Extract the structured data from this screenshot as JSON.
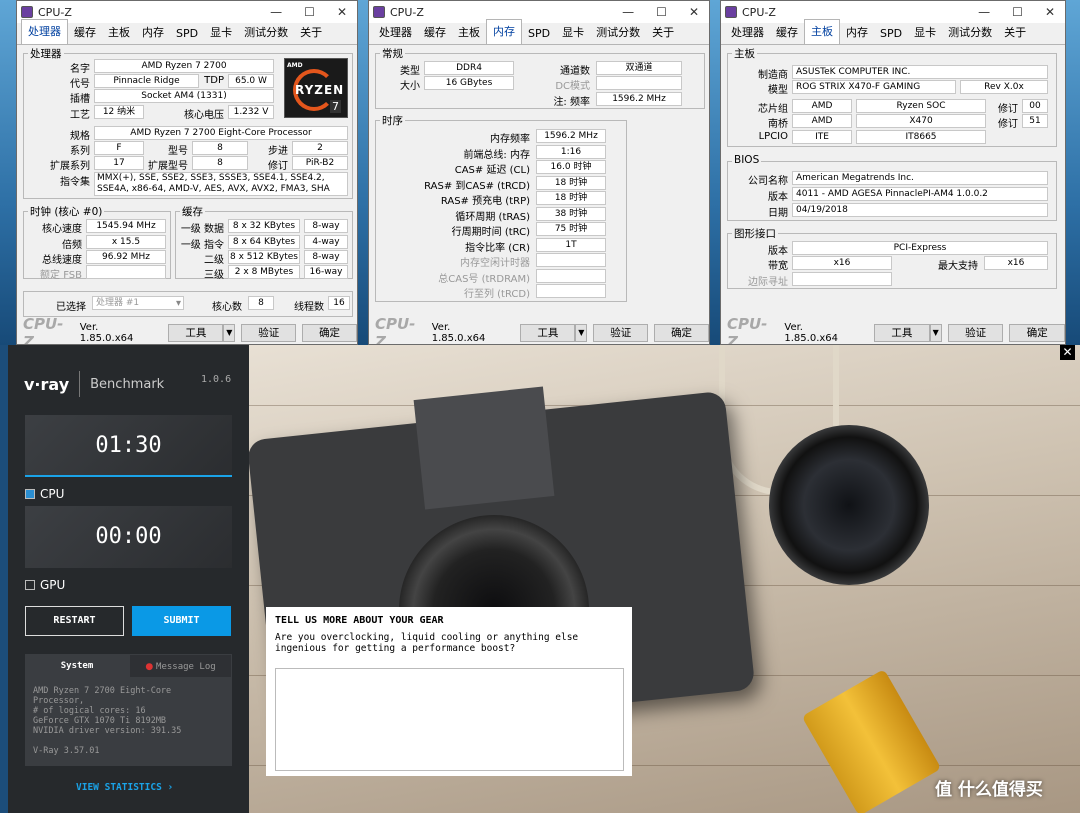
{
  "cpuz_cpu": {
    "title": "CPU-Z",
    "tabs": [
      "处理器",
      "缓存",
      "主板",
      "内存",
      "SPD",
      "显卡",
      "测试分数",
      "关于"
    ],
    "proc_group": "处理器",
    "name_l": "名字",
    "name_v": "AMD Ryzen 7 2700",
    "code_l": "代号",
    "code_v": "Pinnacle Ridge",
    "tdp_l": "TDP",
    "tdp_v": "65.0 W",
    "socket_l": "插槽",
    "socket_v": "Socket AM4 (1331)",
    "tech_l": "工艺",
    "tech_v": "12 纳米",
    "volt_l": "核心电压",
    "volt_v": "1.232 V",
    "spec_l": "规格",
    "spec_v": "AMD Ryzen 7 2700 Eight-Core Processor",
    "fam_l": "系列",
    "fam_v": "F",
    "model_l": "型号",
    "model_v": "8",
    "step_l": "步进",
    "step_v": "2",
    "extfam_l": "扩展系列",
    "extfam_v": "17",
    "extmod_l": "扩展型号",
    "extmod_v": "8",
    "rev_l": "修订",
    "rev_v": "PiR-B2",
    "instr_l": "指令集",
    "instr_v": "MMX(+), SSE, SSE2, SSE3, SSSE3, SSE4.1, SSE4.2, SSE4A, x86-64, AMD-V, AES, AVX, AVX2, FMA3, SHA",
    "clock_group": "时钟 (核心 #0)",
    "corespd_l": "核心速度",
    "corespd_v": "1545.94 MHz",
    "mult_l": "倍频",
    "mult_v": "x 15.5",
    "bus_l": "总线速度",
    "bus_v": "96.92 MHz",
    "fsb_l": "额定 FSB",
    "fsb_v": "",
    "cache_group": "缓存",
    "l1d_l": "一级 数据",
    "l1d_v": "8 x 32 KBytes",
    "l1d_w": "8-way",
    "l1i_l": "一级 指令",
    "l1i_v": "8 x 64 KBytes",
    "l1i_w": "4-way",
    "l2_l": "二级",
    "l2_v": "8 x 512 KBytes",
    "l2_w": "8-way",
    "l3_l": "三级",
    "l3_v": "2 x 8 MBytes",
    "l3_w": "16-way",
    "sel_l": "已选择",
    "sel_v": "处理器 #1",
    "cores_l": "核心数",
    "cores_v": "8",
    "threads_l": "线程数",
    "threads_v": "16",
    "logo": {
      "brand": "AMD",
      "product": "RYZEN",
      "tier": "7"
    }
  },
  "cpuz_mem": {
    "title": "CPU-Z",
    "tabs": [
      "处理器",
      "缓存",
      "主板",
      "内存",
      "SPD",
      "显卡",
      "测试分数",
      "关于"
    ],
    "gen_group": "常规",
    "type_l": "类型",
    "type_v": "DDR4",
    "ch_l": "通道数",
    "ch_v": "双通道",
    "size_l": "大小",
    "size_v": "16 GBytes",
    "dc_l": "DC模式",
    "dc_v": "",
    "nb_l": "注: 频率",
    "nb_v": "1596.2 MHz",
    "tim_group": "时序",
    "rows": [
      {
        "l": "内存频率",
        "v": "1596.2 MHz",
        "dim": false
      },
      {
        "l": "前端总线: 内存",
        "v": "1:16",
        "dim": false
      },
      {
        "l": "CAS# 延迟 (CL)",
        "v": "16.0 时钟",
        "dim": false
      },
      {
        "l": "RAS# 到CAS# (tRCD)",
        "v": "18 时钟",
        "dim": false
      },
      {
        "l": "RAS# 预充电 (tRP)",
        "v": "18 时钟",
        "dim": false
      },
      {
        "l": "循环周期 (tRAS)",
        "v": "38 时钟",
        "dim": false
      },
      {
        "l": "行周期时间 (tRC)",
        "v": "75 时钟",
        "dim": false
      },
      {
        "l": "指令比率 (CR)",
        "v": "1T",
        "dim": false
      },
      {
        "l": "内存空闲计时器",
        "v": "",
        "dim": true
      },
      {
        "l": "总CAS号 (tRDRAM)",
        "v": "",
        "dim": true
      },
      {
        "l": "行至列 (tRCD)",
        "v": "",
        "dim": true
      }
    ]
  },
  "cpuz_mb": {
    "title": "CPU-Z",
    "tabs": [
      "处理器",
      "缓存",
      "主板",
      "内存",
      "SPD",
      "显卡",
      "测试分数",
      "关于"
    ],
    "mb_group": "主板",
    "mfr_l": "制造商",
    "mfr_v": "ASUSTeK COMPUTER INC.",
    "model_l": "模型",
    "model_v": "ROG STRIX X470-F GAMING",
    "model_rev": "Rev X.0x",
    "chip_l": "芯片组",
    "chip_v1": "AMD",
    "chip_v2": "Ryzen SOC",
    "chip_rl": "修订",
    "chip_rv": "00",
    "sb_l": "南桥",
    "sb_v1": "AMD",
    "sb_v2": "X470",
    "sb_rl": "修订",
    "sb_rv": "51",
    "lpc_l": "LPCIO",
    "lpc_v1": "ITE",
    "lpc_v2": "IT8665",
    "bios_group": "BIOS",
    "brand_l": "公司名称",
    "brand_v": "American Megatrends Inc.",
    "ver_l": "版本",
    "ver_v": "4011 - AMD AGESA PinnaclePI-AM4 1.0.0.2",
    "date_l": "日期",
    "date_v": "04/19/2018",
    "gi_group": "图形接口",
    "giver_l": "版本",
    "giver_v": "PCI-Express",
    "gibw_l": "带宽",
    "gibw_v": "x16",
    "gimax_l": "最大支持",
    "gimax_v": "x16",
    "gisb_l": "边际寻址",
    "gisb_v": ""
  },
  "footer": {
    "logo": "CPU-Z",
    "ver": "Ver. 1.85.0.x64",
    "tools": "工具",
    "validate": "验证",
    "ok": "确定"
  },
  "vray": {
    "brand": "v·ray",
    "product": "Benchmark",
    "version": "1.0.6",
    "cpu_time": "01:30",
    "cpu_label": "CPU",
    "cpu_checked": true,
    "gpu_time": "00:00",
    "gpu_label": "GPU",
    "gpu_checked": false,
    "restart": "RESTART",
    "submit": "SUBMIT",
    "tab_system": "System",
    "tab_log": "Message Log",
    "sys_lines": [
      "AMD Ryzen 7 2700 Eight-Core Processor,",
      "# of logical cores: 16",
      "GeForce GTX 1070 Ti 8192MB",
      "NVIDIA driver version: 391.35",
      "",
      "V-Ray 3.57.01"
    ],
    "view_stats": "VIEW STATISTICS ›",
    "form_title": "TELL US MORE ABOUT YOUR GEAR",
    "form_text": "Are you overclocking, liquid cooling or anything else ingenious for getting a performance boost?",
    "close": "✕"
  },
  "watermark": "值 什么值得买",
  "colors": {
    "accent": "#0099e6",
    "submit": "#0a99e6",
    "vray_bg": "#26292c"
  }
}
